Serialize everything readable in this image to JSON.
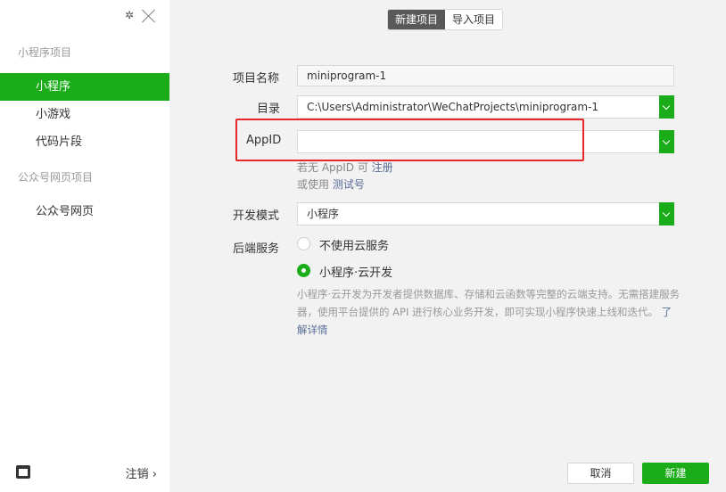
{
  "sidebar": {
    "settings_icon": "gear-icon",
    "close_icon": "close-icon",
    "section_mini": "小程序项目",
    "items_mini": [
      "小程序",
      "小游戏",
      "代码片段"
    ],
    "section_web": "公众号网页项目",
    "items_web": [
      "公众号网页"
    ],
    "logout_label": "注销 ›"
  },
  "tabs": {
    "new_project": "新建项目",
    "import_project": "导入项目"
  },
  "form": {
    "name_label": "项目名称",
    "name_value": "miniprogram-1",
    "dir_label": "目录",
    "dir_value": "C:\\Users\\Administrator\\WeChatProjects\\miniprogram-1",
    "appid_label": "AppID",
    "appid_value": "",
    "hint_register_prefix": "若无 AppID 可 ",
    "hint_register_link": "注册",
    "hint_test_prefix": "或使用 ",
    "hint_test_link": "测试号",
    "mode_label": "开发模式",
    "mode_value": "小程序",
    "backend_label": "后端服务",
    "option_no_cloud": "不使用云服务",
    "option_cloud": "小程序·云开发",
    "cloud_desc": "小程序·云开发为开发者提供数据库、存储和云函数等完整的云端支持。无需搭建服务器，使用平台提供的 API 进行核心业务开发，即可实现小程序快速上线和迭代。",
    "learn_more": "了解详情"
  },
  "buttons": {
    "cancel": "取消",
    "create": "新建"
  },
  "colors": {
    "accent": "#1aad19",
    "highlight": "#e5292a",
    "link": "#576b95"
  }
}
